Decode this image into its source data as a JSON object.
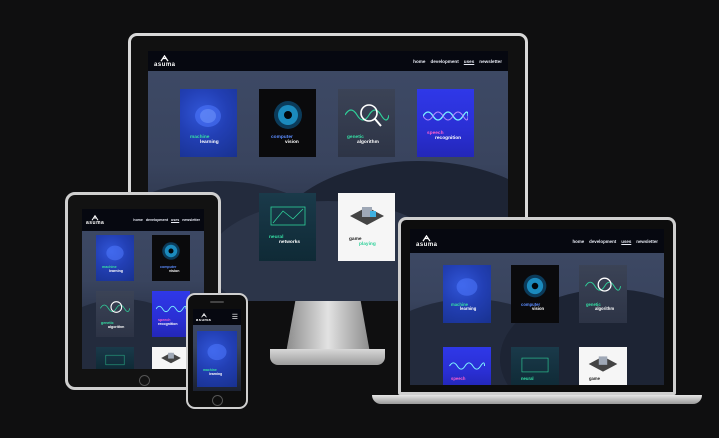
{
  "site": {
    "brand": "asuma",
    "nav": [
      "home",
      "development",
      "uses",
      "newsletter"
    ],
    "active_nav": "uses"
  },
  "cards": {
    "machine_learning": [
      "machine",
      "learning"
    ],
    "computer_vision": [
      "computer",
      "vision"
    ],
    "genetic_algorithm": [
      "genetic",
      "algorithm"
    ],
    "speech_recognition": [
      "speech",
      "recognition"
    ],
    "neural_networks": [
      "neural",
      "networks"
    ],
    "game_playing": [
      "game",
      "playing"
    ]
  },
  "icons": {
    "logo": "asuma-logo-icon",
    "menu": "hamburger-menu-icon"
  },
  "colors": {
    "background": "#0f0f10",
    "navbar": "#060810",
    "accent_green": "#35e0a5",
    "card_blue": "#223fb4",
    "card_purple": "#2f38e8"
  }
}
